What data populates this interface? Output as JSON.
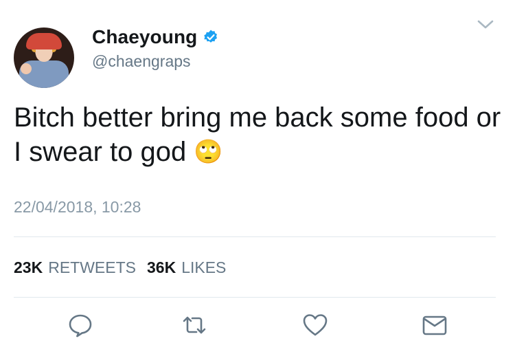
{
  "user": {
    "display_name": "Chaeyoung",
    "handle": "@chaengraps",
    "verified": true
  },
  "tweet": {
    "text": "Bitch better bring me back some food or I swear to god",
    "emoji": "🙄",
    "timestamp": "22/04/2018, 10:28"
  },
  "stats": {
    "retweets_count": "23K",
    "retweets_label": "RETWEETS",
    "likes_count": "36K",
    "likes_label": "LIKES"
  },
  "icons": {
    "menu": "chevron-down-icon",
    "reply": "reply-icon",
    "retweet": "retweet-icon",
    "like": "heart-icon",
    "share": "envelope-icon"
  },
  "colors": {
    "verified": "#1da1f2",
    "icon_gray": "#657786",
    "secondary_text": "#657786",
    "divider": "#e1e8ed"
  }
}
